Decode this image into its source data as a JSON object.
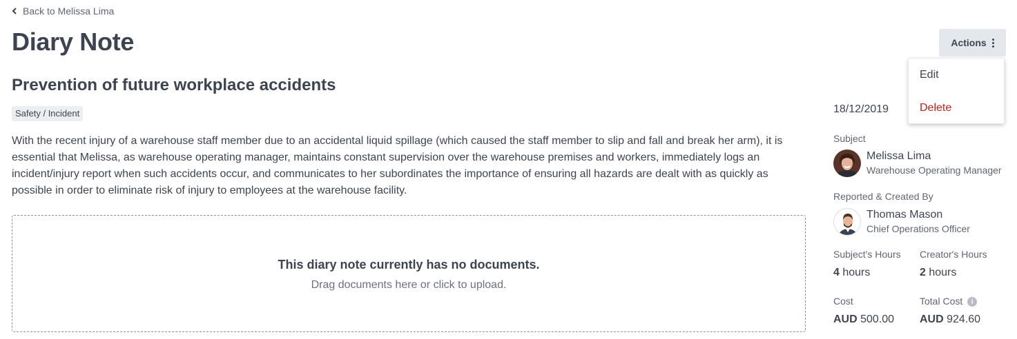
{
  "nav": {
    "back_label": "Back to Melissa Lima"
  },
  "header": {
    "title": "Diary Note",
    "actions_label": "Actions"
  },
  "actions_menu": {
    "edit_label": "Edit",
    "delete_label": "Delete"
  },
  "note": {
    "title": "Prevention of future workplace accidents",
    "category": "Safety / Incident",
    "body": "With the recent injury of a warehouse staff member due to an accidental liquid spillage (which caused the staff member to slip and fall and break her arm), it is essential that Melissa, as warehouse operating manager, maintains constant supervision over the warehouse premises and workers, immediately logs an incident/injury report when such accidents occur, and communicates to her subordinates the importance of ensuring all hazards are dealt with as quickly as possible in order to eliminate risk of injury to employees at the warehouse facility."
  },
  "documents": {
    "empty_title": "This diary note currently has no documents.",
    "upload_hint": "Drag documents here or click to upload."
  },
  "sidebar": {
    "date": "18/12/2019",
    "subject": {
      "label": "Subject",
      "name": "Melissa Lima",
      "role": "Warehouse Operating Manager"
    },
    "reporter": {
      "label": "Reported & Created By",
      "name": "Thomas Mason",
      "role": "Chief Operations Officer"
    },
    "subject_hours": {
      "label": "Subject's Hours",
      "value": "4",
      "unit": "hours"
    },
    "creator_hours": {
      "label": "Creator's Hours",
      "value": "2",
      "unit": "hours"
    },
    "cost": {
      "label": "Cost",
      "currency": "AUD",
      "amount": "500.00"
    },
    "total_cost": {
      "label": "Total Cost",
      "currency": "AUD",
      "amount": "924.60"
    }
  },
  "colors": {
    "text": "#3d4451",
    "muted": "#5f6673",
    "danger": "#b3261e",
    "button_bg": "#e4e7eb",
    "dropzone_border": "#8a8ca8"
  },
  "icons": {
    "back": "chevron-left-icon",
    "actions": "kebab-icon",
    "info": "info-icon"
  }
}
